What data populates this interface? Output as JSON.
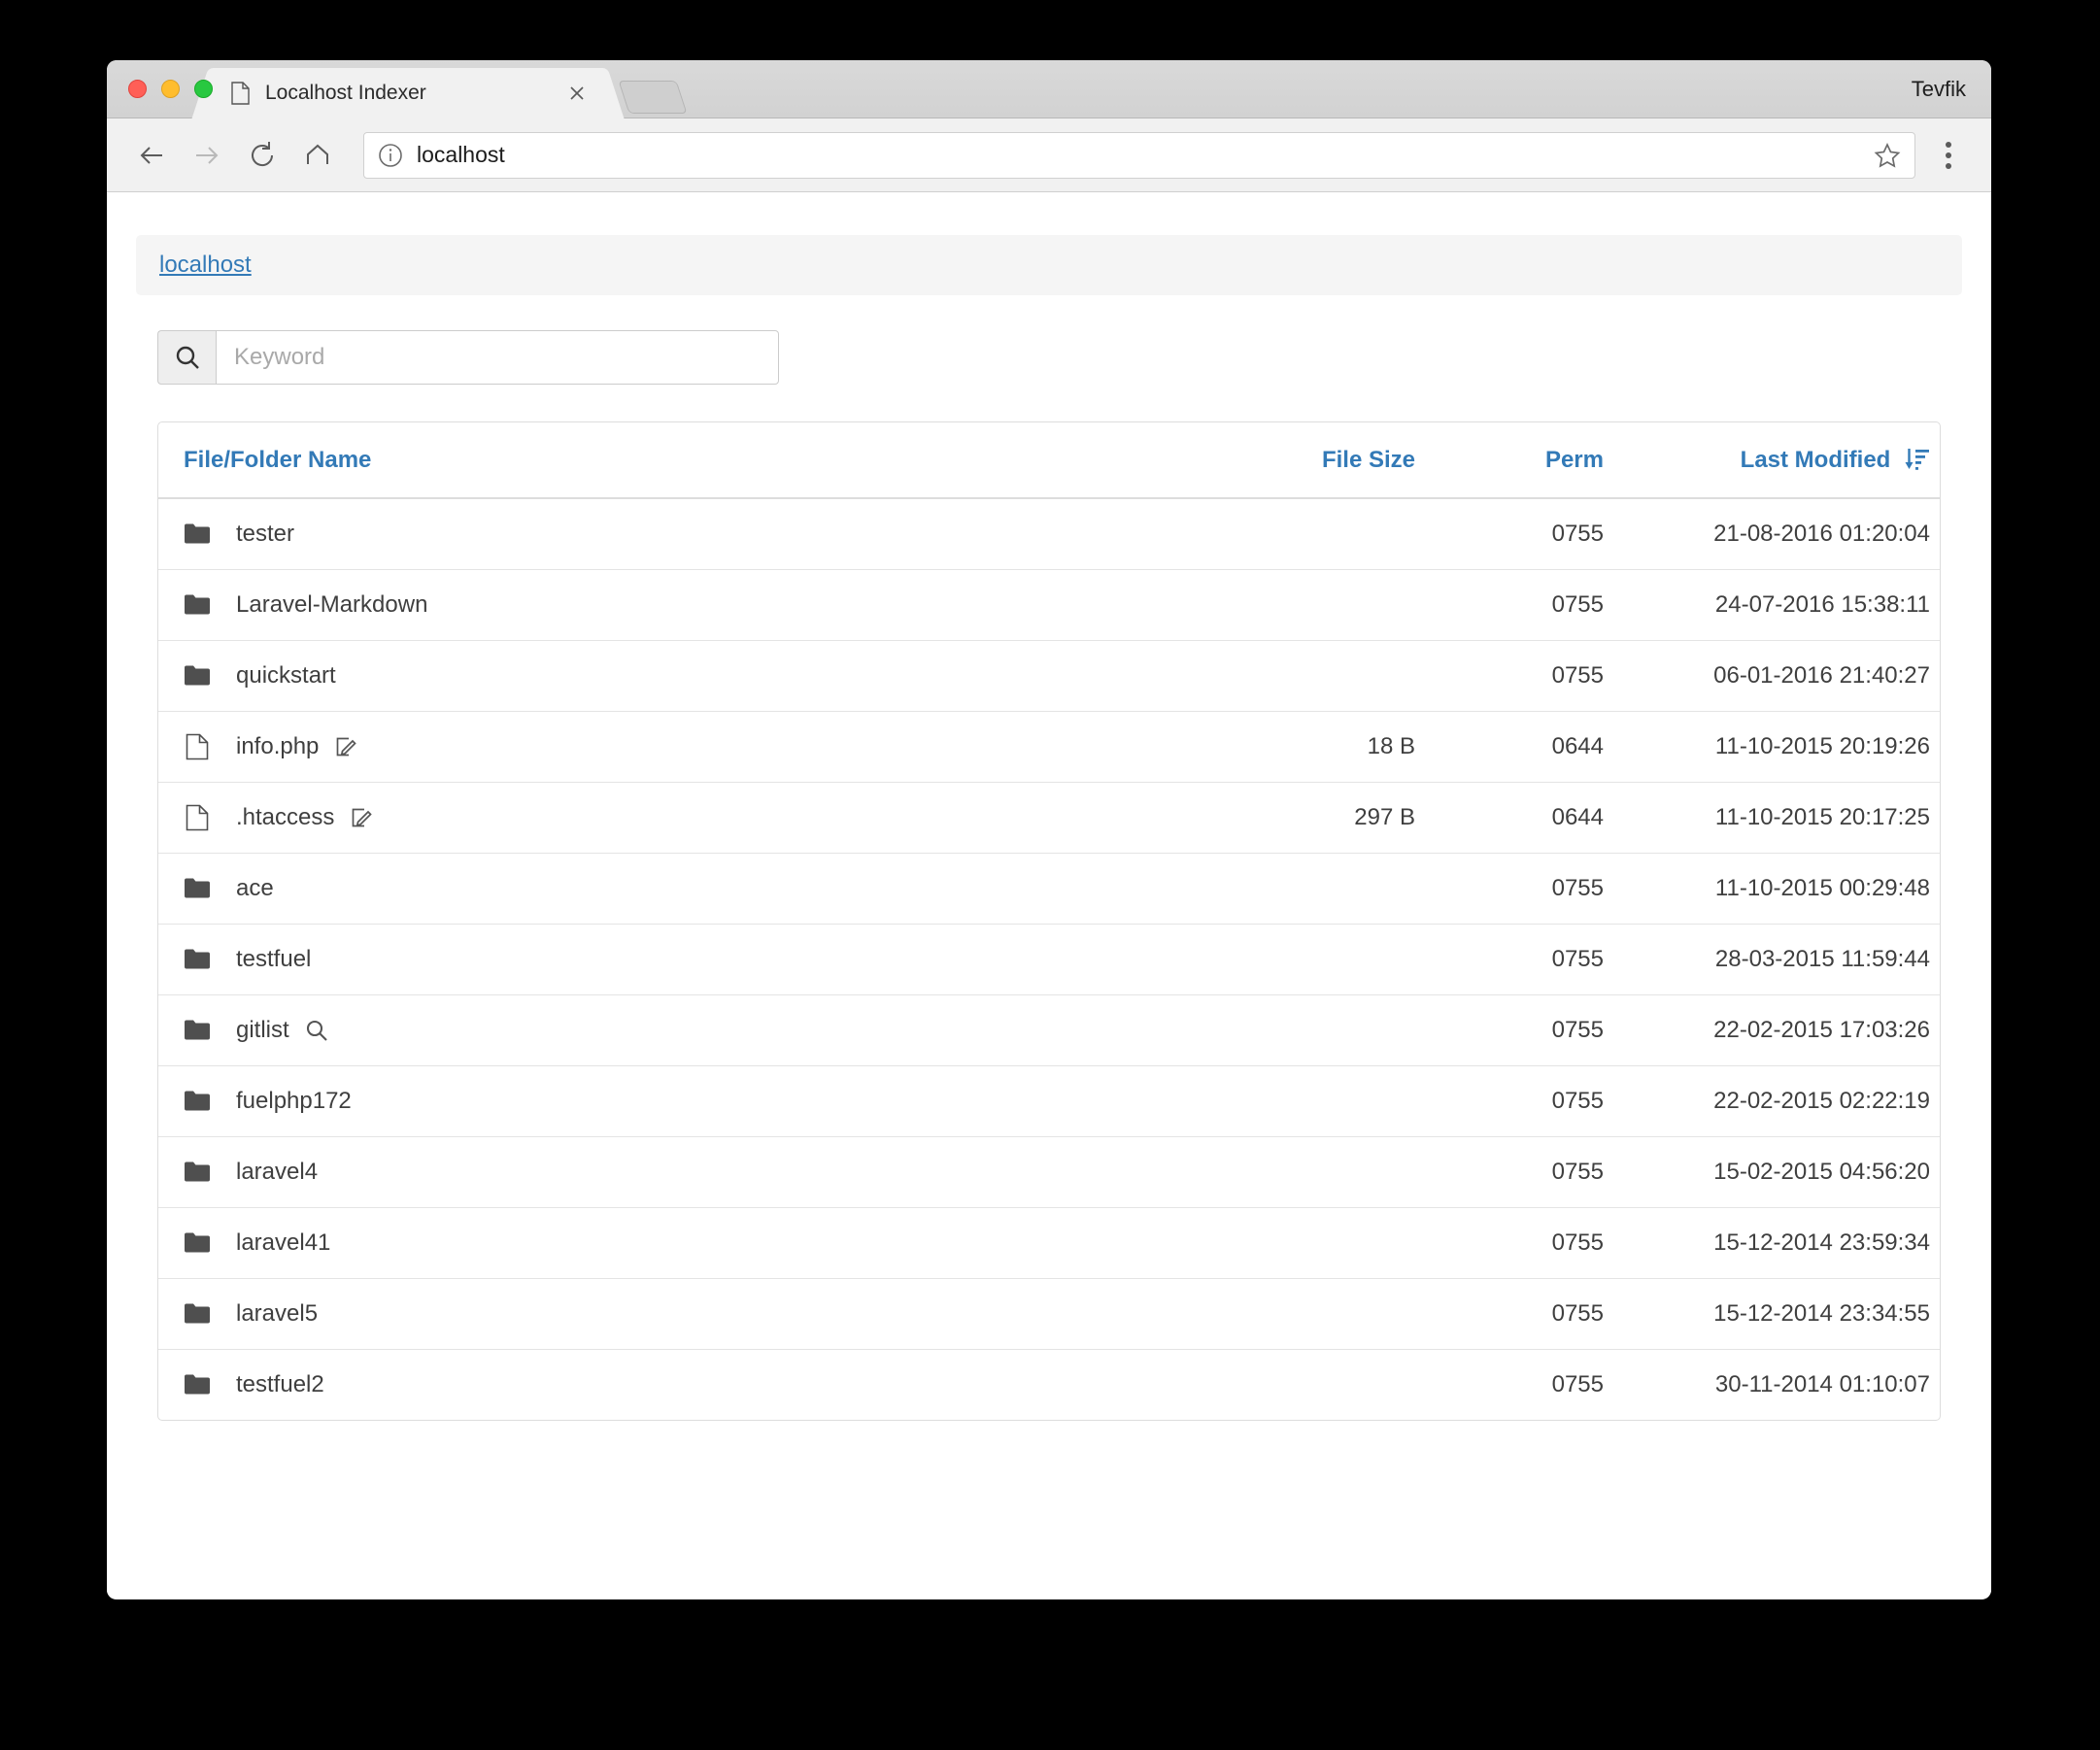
{
  "browser": {
    "tab": {
      "title": "Localhost Indexer",
      "favicon": "document-icon",
      "close": "close-icon"
    },
    "new_tab_label": "",
    "profile_name": "Tevfik",
    "toolbar": {
      "back": "back-arrow-icon",
      "forward": "forward-arrow-icon",
      "reload": "reload-icon",
      "home": "home-icon",
      "url": "localhost",
      "info": "info-circle-icon",
      "bookmark": "star-icon",
      "menu": "three-dots-menu-icon"
    }
  },
  "page": {
    "breadcrumb": "localhost",
    "search": {
      "placeholder": "Keyword",
      "value": "",
      "icon": "search-icon"
    },
    "table": {
      "headers": {
        "name": "File/Folder Name",
        "size": "File Size",
        "perm": "Perm",
        "modified": "Last Modified",
        "sort_icon": "sort-amount-desc-icon"
      },
      "rows": [
        {
          "icon": "folder-icon",
          "name": "tester",
          "action": "",
          "size": "",
          "perm": "0755",
          "modified": "21-08-2016 01:20:04"
        },
        {
          "icon": "folder-icon",
          "name": "Laravel-Markdown",
          "action": "",
          "size": "",
          "perm": "0755",
          "modified": "24-07-2016 15:38:11"
        },
        {
          "icon": "folder-icon",
          "name": "quickstart",
          "action": "",
          "size": "",
          "perm": "0755",
          "modified": "06-01-2016 21:40:27"
        },
        {
          "icon": "file-icon",
          "name": "info.php",
          "action": "edit-icon",
          "size": "18 B",
          "perm": "0644",
          "modified": "11-10-2015 20:19:26"
        },
        {
          "icon": "file-icon",
          "name": ".htaccess",
          "action": "edit-icon",
          "size": "297 B",
          "perm": "0644",
          "modified": "11-10-2015 20:17:25"
        },
        {
          "icon": "folder-icon",
          "name": "ace",
          "action": "",
          "size": "",
          "perm": "0755",
          "modified": "11-10-2015 00:29:48"
        },
        {
          "icon": "folder-icon",
          "name": "testfuel",
          "action": "",
          "size": "",
          "perm": "0755",
          "modified": "28-03-2015 11:59:44"
        },
        {
          "icon": "folder-icon",
          "name": "gitlist",
          "action": "search-icon",
          "size": "",
          "perm": "0755",
          "modified": "22-02-2015 17:03:26"
        },
        {
          "icon": "folder-icon",
          "name": "fuelphp172",
          "action": "",
          "size": "",
          "perm": "0755",
          "modified": "22-02-2015 02:22:19"
        },
        {
          "icon": "folder-icon",
          "name": "laravel4",
          "action": "",
          "size": "",
          "perm": "0755",
          "modified": "15-02-2015 04:56:20"
        },
        {
          "icon": "folder-icon",
          "name": "laravel41",
          "action": "",
          "size": "",
          "perm": "0755",
          "modified": "15-12-2014 23:59:34"
        },
        {
          "icon": "folder-icon",
          "name": "laravel5",
          "action": "",
          "size": "",
          "perm": "0755",
          "modified": "15-12-2014 23:34:55"
        },
        {
          "icon": "folder-icon",
          "name": "testfuel2",
          "action": "",
          "size": "",
          "perm": "0755",
          "modified": "30-11-2014 01:10:07"
        }
      ]
    }
  },
  "colors": {
    "link_blue": "#337ab7",
    "text_dark": "#3f3f3f",
    "panel_border": "#dddddd",
    "breadcrumb_bg": "#f5f5f5"
  }
}
